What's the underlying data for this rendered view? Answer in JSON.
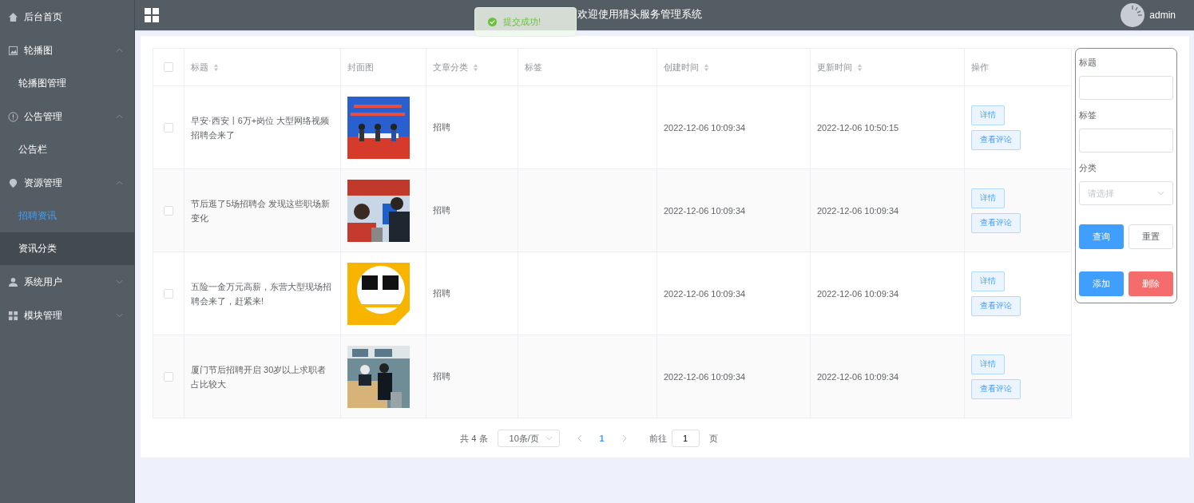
{
  "sidebar": {
    "items": [
      {
        "label": "后台首页"
      },
      {
        "label": "轮播图",
        "expanded": true,
        "children": [
          {
            "label": "轮播图管理",
            "selected": false,
            "hovered": false
          }
        ]
      },
      {
        "label": "公告管理",
        "expanded": true,
        "children": [
          {
            "label": "公告栏",
            "selected": false,
            "hovered": false
          }
        ]
      },
      {
        "label": "资源管理",
        "expanded": true,
        "children": [
          {
            "label": "招聘资讯",
            "selected": true,
            "hovered": false
          },
          {
            "label": "资讯分类",
            "selected": false,
            "hovered": true
          }
        ]
      },
      {
        "label": "系统用户",
        "expanded": false
      },
      {
        "label": "模块管理",
        "expanded": false
      }
    ]
  },
  "header": {
    "title": "欢迎使用猎头服务管理系统",
    "user": "admin"
  },
  "toast": {
    "message": "提交成功!"
  },
  "table": {
    "select_all_checked": false,
    "columns": [
      {
        "label": "标题",
        "sortable": true
      },
      {
        "label": "封面图",
        "sortable": false
      },
      {
        "label": "文章分类",
        "sortable": true
      },
      {
        "label": "标签",
        "sortable": false
      },
      {
        "label": "创建时间",
        "sortable": true
      },
      {
        "label": "更新时间",
        "sortable": true
      },
      {
        "label": "操作",
        "sortable": false
      }
    ],
    "rows": [
      {
        "checked": false,
        "title": "早安·西安丨6万+岗位 大型网络视频招聘会来了",
        "category": "招聘",
        "created": "2022-12-06 10:09:34",
        "updated": "2022-12-06 10:50:15",
        "actions": [
          "详情",
          "查看评论"
        ]
      },
      {
        "checked": false,
        "title": "节后逛了5场招聘会 发现这些职场新变化",
        "category": "招聘",
        "created": "2022-12-06 10:09:34",
        "updated": "2022-12-06 10:09:34",
        "actions": [
          "详情",
          "查看评论"
        ]
      },
      {
        "checked": false,
        "title": "五险一金万元高薪，东营大型现场招聘会来了，赶紧来!",
        "category": "招聘",
        "created": "2022-12-06 10:09:34",
        "updated": "2022-12-06 10:09:34",
        "actions": [
          "详情",
          "查看评论"
        ]
      },
      {
        "checked": false,
        "title": "厦门节后招聘开启 30岁以上求职者占比较大",
        "category": "招聘",
        "created": "2022-12-06 10:09:34",
        "updated": "2022-12-06 10:09:34",
        "actions": [
          "详情",
          "查看评论"
        ]
      }
    ]
  },
  "pagination": {
    "total": "共 4 条",
    "page_size": "10条/页",
    "pages": [
      {
        "label": "1",
        "selected": true
      }
    ],
    "goto_label": "前往",
    "goto_value": "1",
    "goto_suffix": "页"
  },
  "filter": {
    "fields": [
      {
        "label": "标题",
        "kind": "input"
      },
      {
        "label": "标签",
        "kind": "input"
      },
      {
        "label": "分类",
        "kind": "select",
        "placeholder": "请选择"
      }
    ],
    "buttons": [
      {
        "label": "查询",
        "kind": "primary"
      },
      {
        "label": "重置",
        "kind": "plain"
      },
      {
        "label": "添加",
        "kind": "primary"
      },
      {
        "label": "删除",
        "kind": "danger"
      }
    ]
  }
}
